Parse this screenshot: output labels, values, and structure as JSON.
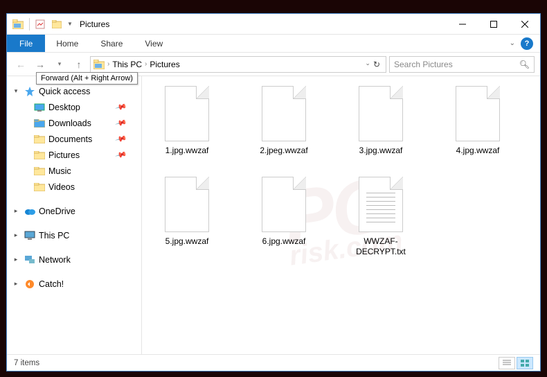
{
  "titlebar": {
    "title": "Pictures"
  },
  "ribbon": {
    "file": "File",
    "tabs": [
      "Home",
      "Share",
      "View"
    ]
  },
  "address": {
    "crumbs": [
      "This PC",
      "Pictures"
    ],
    "tooltip": "Forward (Alt + Right Arrow)"
  },
  "search": {
    "placeholder": "Search Pictures"
  },
  "nav": {
    "top": {
      "label": "Quick access"
    },
    "pinned": [
      {
        "label": "Desktop",
        "icon": "desktop"
      },
      {
        "label": "Downloads",
        "icon": "downloads"
      },
      {
        "label": "Documents",
        "icon": "documents"
      },
      {
        "label": "Pictures",
        "icon": "pictures"
      },
      {
        "label": "Music",
        "icon": "music"
      },
      {
        "label": "Videos",
        "icon": "videos"
      }
    ],
    "roots": [
      {
        "label": "OneDrive",
        "icon": "onedrive"
      },
      {
        "label": "This PC",
        "icon": "thispc"
      },
      {
        "label": "Network",
        "icon": "network"
      },
      {
        "label": "Catch!",
        "icon": "catch"
      }
    ]
  },
  "files": [
    {
      "name": "1.jpg.wwzaf",
      "type": "blank"
    },
    {
      "name": "2.jpeg.wwzaf",
      "type": "blank"
    },
    {
      "name": "3.jpg.wwzaf",
      "type": "blank"
    },
    {
      "name": "4.jpg.wwzaf",
      "type": "blank"
    },
    {
      "name": "5.jpg.wwzaf",
      "type": "blank"
    },
    {
      "name": "6.jpg.wwzaf",
      "type": "blank"
    },
    {
      "name": "WWZAF-DECRYPT.txt",
      "type": "txt"
    }
  ],
  "status": {
    "count": "7 items"
  }
}
